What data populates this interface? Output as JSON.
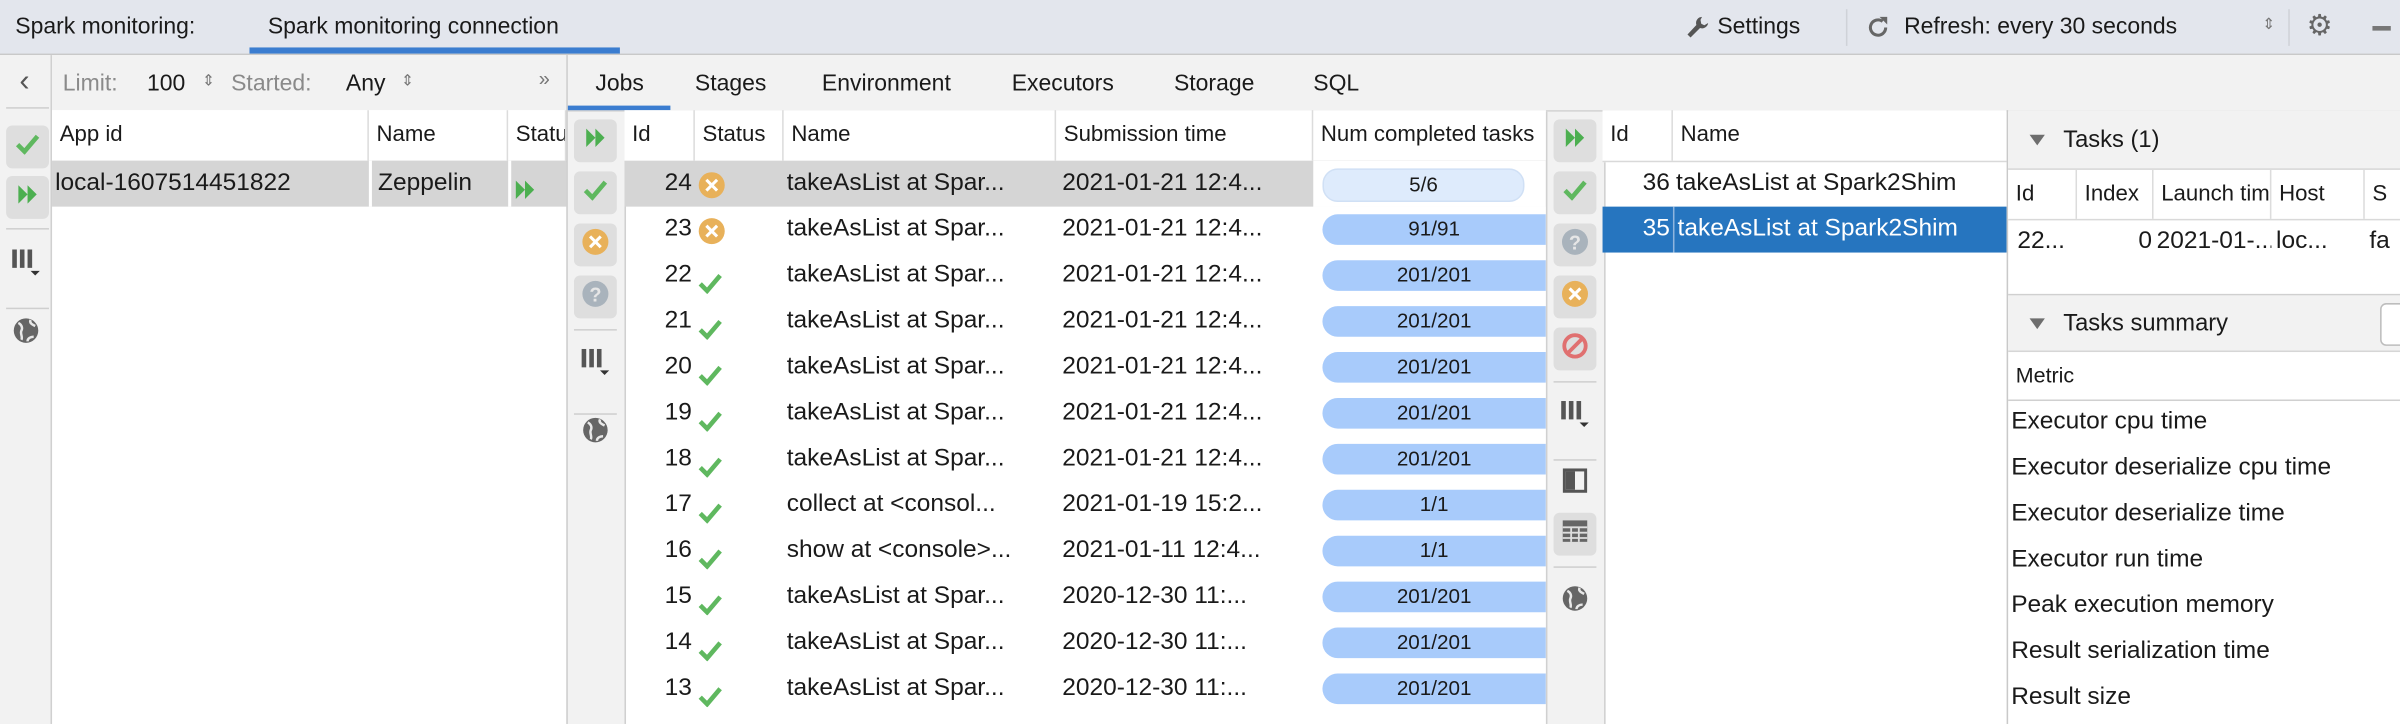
{
  "topbar": {
    "label": "Spark monitoring:",
    "connection_tab": "Spark monitoring connection",
    "settings": "Settings",
    "refresh": "Refresh: every 30 seconds"
  },
  "apps": {
    "limit_label": "Limit:",
    "limit_value": "100",
    "started_label": "Started:",
    "started_value": "Any",
    "more": "»",
    "columns": [
      "App id",
      "Name",
      "Status"
    ],
    "rows": [
      {
        "app_id": "local-1607514451822",
        "name": "Zeppelin",
        "status": "running"
      }
    ]
  },
  "tabs": [
    "Jobs",
    "Stages",
    "Environment",
    "Executors",
    "Storage",
    "SQL"
  ],
  "active_tab": "Jobs",
  "jobs": {
    "columns": [
      "Id",
      "Status",
      "Name",
      "Submission time",
      "Num completed tasks"
    ],
    "rows": [
      {
        "id": "24",
        "status": "failed",
        "name": "takeAsList at Spar...",
        "time": "2021-01-21 12:4...",
        "tasks": "5/6",
        "progress": 0.83
      },
      {
        "id": "23",
        "status": "failed",
        "name": "takeAsList at Spar...",
        "time": "2021-01-21 12:4...",
        "tasks": "91/91",
        "progress": 1
      },
      {
        "id": "22",
        "status": "succeeded",
        "name": "takeAsList at Spar...",
        "time": "2021-01-21 12:4...",
        "tasks": "201/201",
        "progress": 1
      },
      {
        "id": "21",
        "status": "succeeded",
        "name": "takeAsList at Spar...",
        "time": "2021-01-21 12:4...",
        "tasks": "201/201",
        "progress": 1
      },
      {
        "id": "20",
        "status": "succeeded",
        "name": "takeAsList at Spar...",
        "time": "2021-01-21 12:4...",
        "tasks": "201/201",
        "progress": 1
      },
      {
        "id": "19",
        "status": "succeeded",
        "name": "takeAsList at Spar...",
        "time": "2021-01-21 12:4...",
        "tasks": "201/201",
        "progress": 1
      },
      {
        "id": "18",
        "status": "succeeded",
        "name": "takeAsList at Spar...",
        "time": "2021-01-21 12:4...",
        "tasks": "201/201",
        "progress": 1
      },
      {
        "id": "17",
        "status": "succeeded",
        "name": "collect at <consol...",
        "time": "2021-01-19 15:2...",
        "tasks": "1/1",
        "progress": 1
      },
      {
        "id": "16",
        "status": "succeeded",
        "name": "show at <console>...",
        "time": "2021-01-11 12:4...",
        "tasks": "1/1",
        "progress": 1
      },
      {
        "id": "15",
        "status": "succeeded",
        "name": "takeAsList at Spar...",
        "time": "2020-12-30 11:...",
        "tasks": "201/201",
        "progress": 1
      },
      {
        "id": "14",
        "status": "succeeded",
        "name": "takeAsList at Spar...",
        "time": "2020-12-30 11:...",
        "tasks": "201/201",
        "progress": 1
      },
      {
        "id": "13",
        "status": "succeeded",
        "name": "takeAsList at Spar...",
        "time": "2020-12-30 11:...",
        "tasks": "201/201",
        "progress": 1
      }
    ]
  },
  "stages": {
    "columns": [
      "Id",
      "Name"
    ],
    "rows": [
      {
        "id": "36",
        "name": "takeAsList at Spark2Shim"
      },
      {
        "id": "35",
        "name": "takeAsList at Spark2Shim",
        "selected": true
      }
    ]
  },
  "tasks": {
    "title": "Tasks (1)",
    "columns": [
      "Id",
      "Index",
      "Launch time",
      "Host",
      "S"
    ],
    "rows": [
      {
        "id": "22...",
        "index": "0",
        "launch": "2021-01-...",
        "host": "loc...",
        "s": "fa"
      }
    ]
  },
  "summary": {
    "title": "Tasks summary",
    "metric_header": "Metric",
    "metrics": [
      "Executor cpu time",
      "Executor deserialize cpu time",
      "Executor deserialize time",
      "Executor run time",
      "Peak execution memory",
      "Result serialization time",
      "Result size"
    ]
  },
  "colors": {
    "accent": "#3b7dd0",
    "selection": "#2675bf",
    "success": "#5fb85f",
    "failed": "#e8b15a",
    "progress": "#a8cbfb"
  }
}
